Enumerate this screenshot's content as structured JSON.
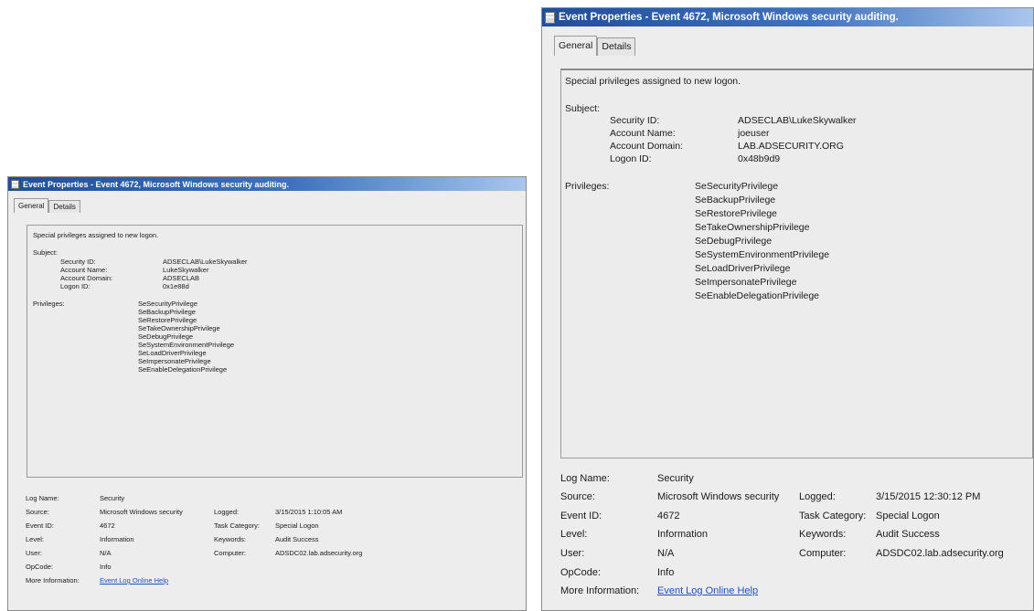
{
  "windows": [
    {
      "title": "Event Properties - Event 4672, Microsoft Windows security auditing.",
      "tabs": [
        "General",
        "Details"
      ],
      "message": {
        "summary": "Special privileges assigned to new logon.",
        "subject_label": "Subject:",
        "subject_fields": [
          {
            "label": "Security ID:",
            "value": "ADSECLAB\\LukeSkywalker"
          },
          {
            "label": "Account Name:",
            "value": "LukeSkywalker"
          },
          {
            "label": "Account Domain:",
            "value": "ADSECLAB"
          },
          {
            "label": "Logon ID:",
            "value": "0x1e88d"
          }
        ],
        "privileges_label": "Privileges:",
        "privileges": [
          "SeSecurityPrivilege",
          "SeBackupPrivilege",
          "SeRestorePrivilege",
          "SeTakeOwnershipPrivilege",
          "SeDebugPrivilege",
          "SeSystemEnvironmentPrivilege",
          "SeLoadDriverPrivilege",
          "SeImpersonatePrivilege",
          "SeEnableDelegationPrivilege"
        ]
      },
      "details": {
        "log_name": {
          "label": "Log Name:",
          "value": "Security"
        },
        "source": {
          "label": "Source:",
          "value": "Microsoft Windows security"
        },
        "logged": {
          "label": "Logged:",
          "value": "3/15/2015 1:10:05 AM"
        },
        "event_id": {
          "label": "Event ID:",
          "value": "4672"
        },
        "task_category": {
          "label": "Task Category:",
          "value": "Special Logon"
        },
        "level": {
          "label": "Level:",
          "value": "Information"
        },
        "keywords": {
          "label": "Keywords:",
          "value": "Audit Success"
        },
        "user": {
          "label": "User:",
          "value": "N/A"
        },
        "computer": {
          "label": "Computer:",
          "value": "ADSDC02.lab.adsecurity.org"
        },
        "opcode": {
          "label": "OpCode:",
          "value": "Info"
        },
        "more_info": {
          "label": "More Information:",
          "value": "Event Log Online Help"
        }
      }
    },
    {
      "title": "Event Properties - Event 4672, Microsoft Windows security auditing.",
      "tabs": [
        "General",
        "Details"
      ],
      "message": {
        "summary": "Special privileges assigned to new logon.",
        "subject_label": "Subject:",
        "subject_fields": [
          {
            "label": "Security ID:",
            "value": "ADSECLAB\\LukeSkywalker"
          },
          {
            "label": "Account Name:",
            "value": "joeuser"
          },
          {
            "label": "Account Domain:",
            "value": "LAB.ADSECURITY.ORG"
          },
          {
            "label": "Logon ID:",
            "value": "0x48b9d9"
          }
        ],
        "privileges_label": "Privileges:",
        "privileges": [
          "SeSecurityPrivilege",
          "SeBackupPrivilege",
          "SeRestorePrivilege",
          "SeTakeOwnershipPrivilege",
          "SeDebugPrivilege",
          "SeSystemEnvironmentPrivilege",
          "SeLoadDriverPrivilege",
          "SeImpersonatePrivilege",
          "SeEnableDelegationPrivilege"
        ]
      },
      "details": {
        "log_name": {
          "label": "Log Name:",
          "value": "Security"
        },
        "source": {
          "label": "Source:",
          "value": "Microsoft Windows security"
        },
        "logged": {
          "label": "Logged:",
          "value": "3/15/2015 12:30:12 PM"
        },
        "event_id": {
          "label": "Event ID:",
          "value": "4672"
        },
        "task_category": {
          "label": "Task Category:",
          "value": "Special Logon"
        },
        "level": {
          "label": "Level:",
          "value": "Information"
        },
        "keywords": {
          "label": "Keywords:",
          "value": "Audit Success"
        },
        "user": {
          "label": "User:",
          "value": "N/A"
        },
        "computer": {
          "label": "Computer:",
          "value": "ADSDC02.lab.adsecurity.org"
        },
        "opcode": {
          "label": "OpCode:",
          "value": "Info"
        },
        "more_info": {
          "label": "More Information:",
          "value": "Event Log Online Help"
        }
      }
    }
  ]
}
